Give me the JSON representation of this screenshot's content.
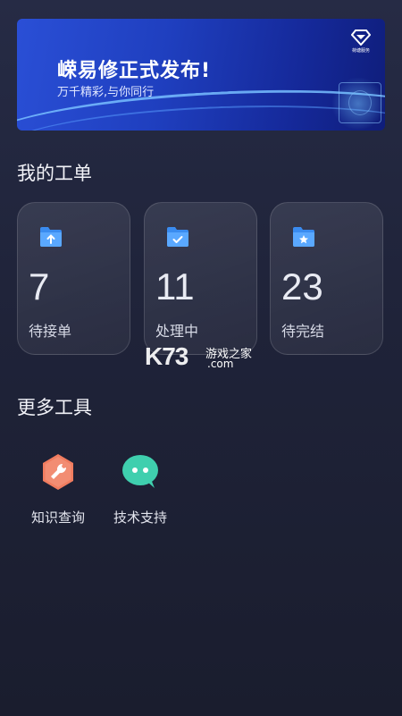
{
  "banner": {
    "title": "嵘易修正式发布!",
    "subtitle": "万千精彩,与你同行",
    "brand_icon": "diamond-logo-icon",
    "brand_text": "荷塘服务"
  },
  "work_orders": {
    "title": "我的工单",
    "cards": [
      {
        "count": "7",
        "label": "待接单",
        "icon": "folder-upload-icon"
      },
      {
        "count": "11",
        "label": "处理中",
        "icon": "folder-check-icon"
      },
      {
        "count": "23",
        "label": "待完结",
        "icon": "folder-star-icon"
      }
    ]
  },
  "watermark": {
    "logo": "K73",
    "text": "游戏之家",
    "domain": ".com"
  },
  "tools": {
    "title": "更多工具",
    "items": [
      {
        "label": "知识查询",
        "icon": "wrench-icon",
        "color": "#f07c5f"
      },
      {
        "label": "技术支持",
        "icon": "chat-bubble-icon",
        "color": "#3fcfae"
      }
    ]
  },
  "colors": {
    "background": "#22263d",
    "banner_blue": "#1f3fbf",
    "folder_blue": "#3a8cf0"
  }
}
